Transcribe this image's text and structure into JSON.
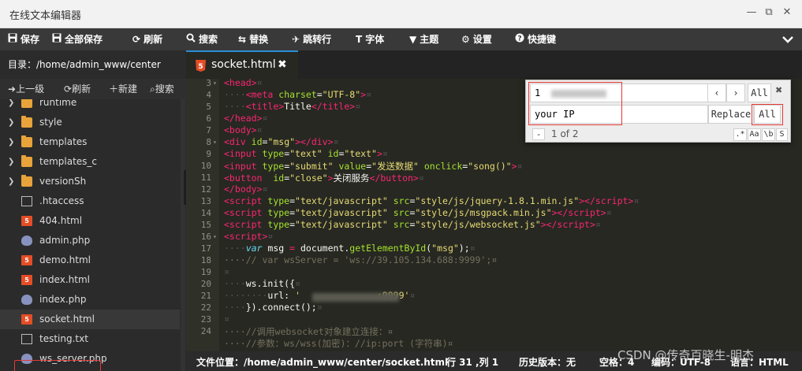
{
  "window": {
    "title": "在线文本编辑器",
    "minimize": "—",
    "maximize": "⧉",
    "close": "✕"
  },
  "toolbar": {
    "save": "保存",
    "save_all": "全部保存",
    "refresh": "刷新",
    "search": "搜索",
    "replace": "替换",
    "goto_line": "跳转行",
    "font": "字体",
    "theme": "主题",
    "settings": "设置",
    "shortcuts": "快捷键"
  },
  "sidebar": {
    "directory": "目录：/home/admin_www/center",
    "up": "上一级",
    "refresh": "刷新",
    "new": "新建",
    "search": "搜索",
    "items": [
      {
        "name": "runtime",
        "type": "folder"
      },
      {
        "name": "style",
        "type": "folder"
      },
      {
        "name": "templates",
        "type": "folder"
      },
      {
        "name": "templates_c",
        "type": "folder"
      },
      {
        "name": "versionSh",
        "type": "folder"
      },
      {
        "name": ".htaccess",
        "type": "text"
      },
      {
        "name": "404.html",
        "type": "html"
      },
      {
        "name": "admin.php",
        "type": "php"
      },
      {
        "name": "demo.html",
        "type": "html"
      },
      {
        "name": "index.html",
        "type": "html"
      },
      {
        "name": "index.php",
        "type": "php"
      },
      {
        "name": "socket.html",
        "type": "html",
        "selected": true
      },
      {
        "name": "testing.txt",
        "type": "text"
      },
      {
        "name": "ws_server.php",
        "type": "php"
      }
    ]
  },
  "tab": {
    "name": "socket.html",
    "close": "✖"
  },
  "editor": {
    "line_numbers": [
      "3",
      "4",
      "5",
      "6",
      "7",
      "8",
      "9",
      "10",
      "11",
      "12",
      "13",
      "14",
      "15",
      "16",
      "17",
      "18",
      "19",
      "20",
      "21",
      "22",
      "23",
      "24"
    ],
    "fold_markers": [
      "▾",
      "",
      "",
      "",
      "",
      "▾",
      "",
      "",
      "",
      "",
      "",
      "",
      "",
      "▾",
      "",
      "",
      "",
      "",
      "",
      "",
      "",
      ""
    ]
  },
  "find": {
    "search_value": "1",
    "replace_value": "your IP",
    "all_label": "All",
    "replace_label": "Replace",
    "replace_all_label": "All",
    "count": "1 of 2",
    "minus": "-",
    "regex": ".*",
    "case": "Aa",
    "word": "\\b",
    "selection": "S",
    "prev": "‹",
    "next": "›",
    "close": "✖"
  },
  "statusbar": {
    "location": "文件位置：/home/admin_www/center/socket.html",
    "cursor": "行 31 ,列 1",
    "history": "历史版本：无",
    "spaces": "空格：4",
    "encoding": "编码：UTF-8",
    "language": "语言：HTML"
  },
  "watermark": "CSDN @传奇百晓生-明杰",
  "colors": {
    "accent": "#2a8fd3",
    "tag": "#f92672",
    "attr": "#a6e22e",
    "string": "#e6db74",
    "comment": "#75715e",
    "keyword": "#66d9ef"
  }
}
